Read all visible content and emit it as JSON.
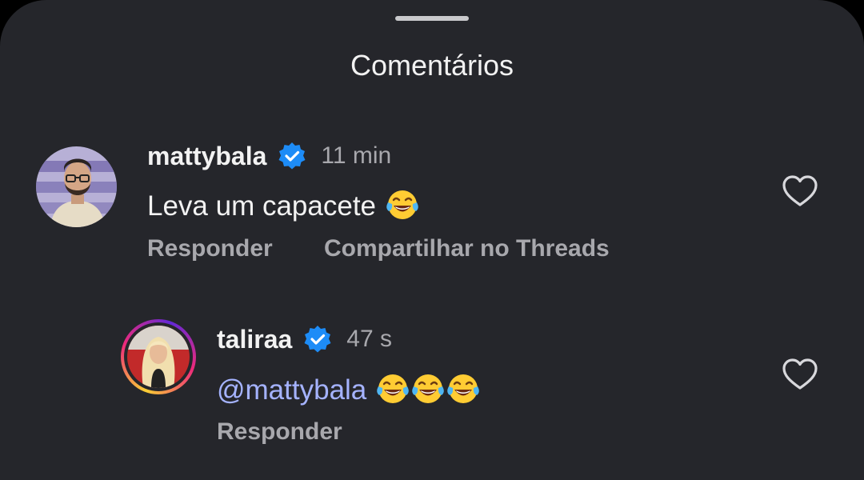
{
  "sheet": {
    "title": "Comentários"
  },
  "comments": [
    {
      "username": "mattybala",
      "time": "11 min",
      "text": "Leva um capacete",
      "emojis": [
        "face-with-tears-of-joy"
      ],
      "actions": [
        "Responder",
        "Compartilhar no Threads"
      ],
      "verified": true
    },
    {
      "username": "taliraa",
      "time": "47 s",
      "mention_prefix": "@",
      "mention": "mattybala",
      "emojis": [
        "face-with-tears-of-joy",
        "face-with-tears-of-joy",
        "face-with-tears-of-joy"
      ],
      "actions": [
        "Responder"
      ],
      "verified": true
    }
  ],
  "colors": {
    "background": "#25262b",
    "text": "#f2f2f2",
    "secondary_text": "#a8a8ad",
    "verified": "#1d8cf7",
    "mention": "#a5b3ff"
  }
}
